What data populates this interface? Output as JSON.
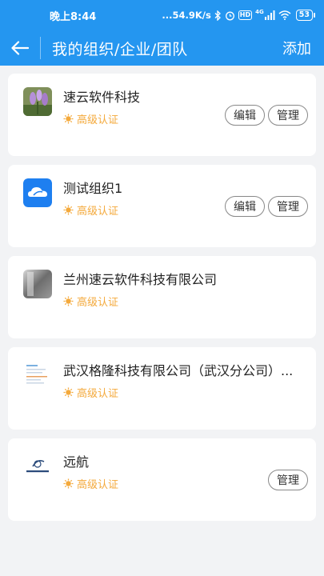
{
  "status": {
    "time": "晚上8:44",
    "speed": "...54.9K/s",
    "network": "4G",
    "battery": "53"
  },
  "header": {
    "title": "我的组织/企业/团队",
    "add_label": "添加"
  },
  "colors": {
    "brand": "#2496f0",
    "badge": "#f4a93b"
  },
  "orgs": [
    {
      "name": "速云软件科技",
      "badge": "高级认证",
      "edit": "编辑",
      "manage": "管理",
      "logo": "purple-flower-photo"
    },
    {
      "name": "测试组织1",
      "badge": "高级认证",
      "edit": "编辑",
      "manage": "管理",
      "logo": "cloud-logo"
    },
    {
      "name": "兰州速云软件科技有限公司",
      "badge": "高级认证",
      "logo": "gray-photo"
    },
    {
      "name": "武汉格隆科技有限公司（武汉分公司）...",
      "badge": "高级认证",
      "logo": "document-thumbnail"
    },
    {
      "name": "远航",
      "badge": "高级认证",
      "manage": "管理",
      "logo": "yuanhang-logo"
    }
  ]
}
